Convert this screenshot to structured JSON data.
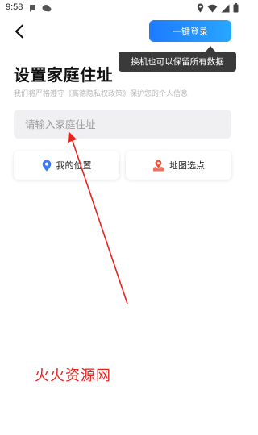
{
  "status_bar": {
    "time": "9:58"
  },
  "header": {
    "login_button_label": "一键登录",
    "tooltip_text": "换机也可以保留所有数据"
  },
  "main": {
    "title": "设置家庭住址",
    "subtitle": "我们将严格遵守《高德隐私权政策》保护您的个人信息",
    "address_input": {
      "placeholder": "请输入家庭住址",
      "value": ""
    },
    "my_location_label": "我的位置",
    "map_pick_label": "地图选点"
  },
  "overlay": {
    "watermark_text": "火火资源网"
  },
  "colors": {
    "accent": "#1e7bff",
    "my_location_icon": "#3b7bf6",
    "map_pick_icon": "#f2553c",
    "annotation": "#e8231e"
  }
}
